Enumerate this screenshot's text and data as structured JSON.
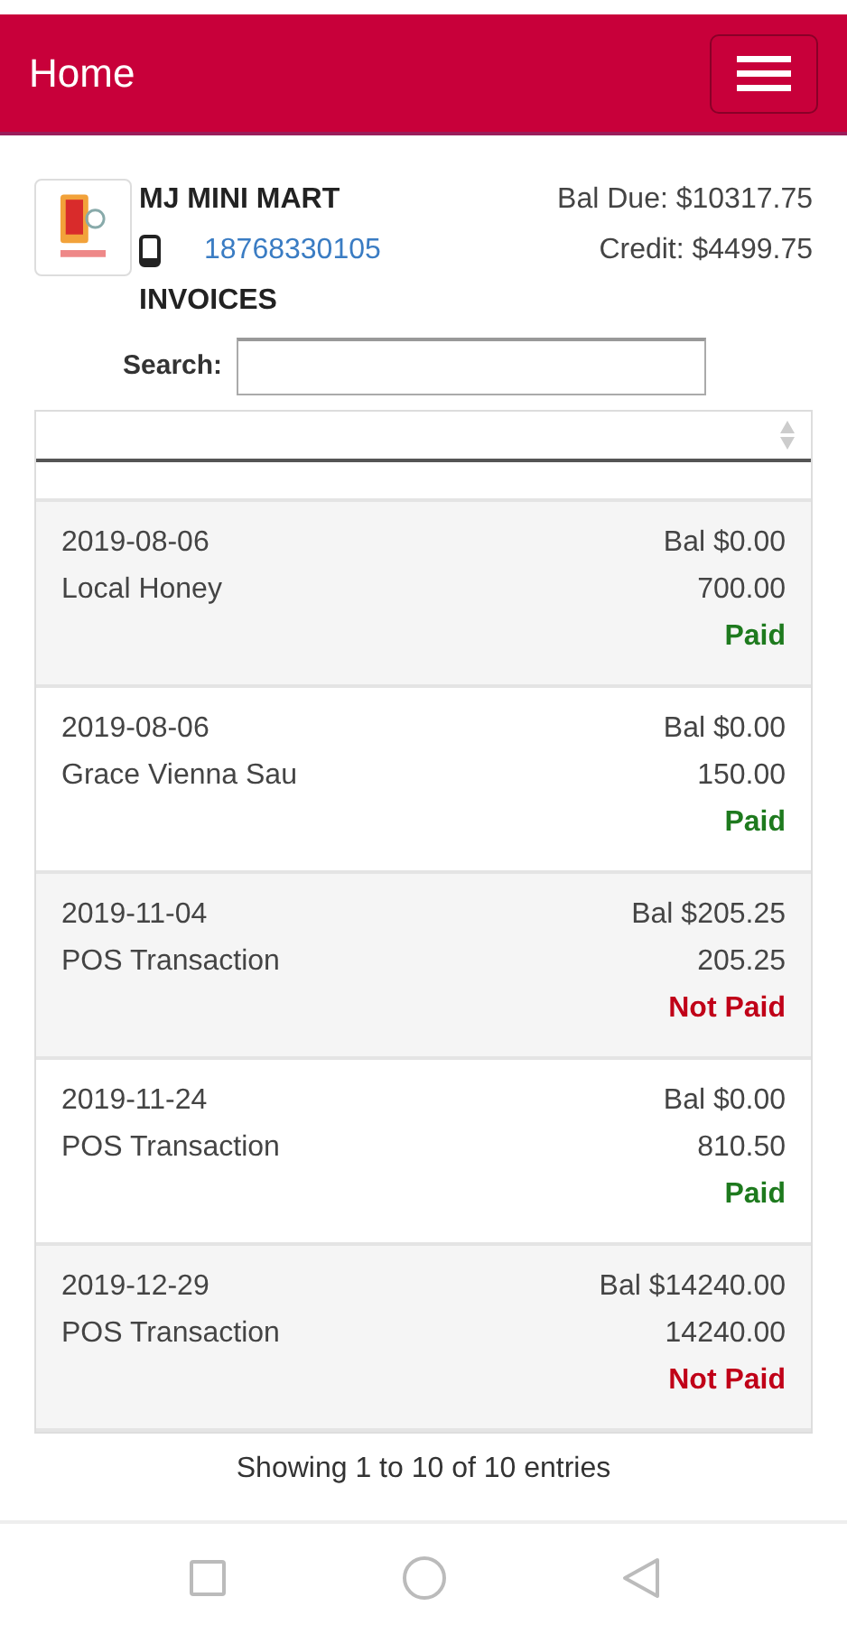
{
  "app_bar": {
    "title": "Home"
  },
  "customer": {
    "name": "MJ MINI MART",
    "phone": "18768330105",
    "bal_due": "Bal Due: $10317.75",
    "credit": "Credit: $4499.75",
    "section": "INVOICES"
  },
  "search": {
    "label": "Search:"
  },
  "rows": [
    {
      "date": "2019-08-06",
      "description": "Local Honey",
      "balance": "Bal $0.00",
      "amount": "700.00",
      "status": "Paid",
      "paid": true
    },
    {
      "date": "2019-08-06",
      "description": "Grace Vienna Sau",
      "balance": "Bal $0.00",
      "amount": "150.00",
      "status": "Paid",
      "paid": true
    },
    {
      "date": "2019-11-04",
      "description": "POS Transaction",
      "balance": "Bal $205.25",
      "amount": "205.25",
      "status": "Not Paid",
      "paid": false
    },
    {
      "date": "2019-11-24",
      "description": "POS Transaction",
      "balance": "Bal $0.00",
      "amount": "810.50",
      "status": "Paid",
      "paid": true
    },
    {
      "date": "2019-12-29",
      "description": "POS Transaction",
      "balance": "Bal $14240.00",
      "amount": "14240.00",
      "status": "Not Paid",
      "paid": false
    }
  ],
  "info": "Showing 1 to 10 of 10 entries"
}
